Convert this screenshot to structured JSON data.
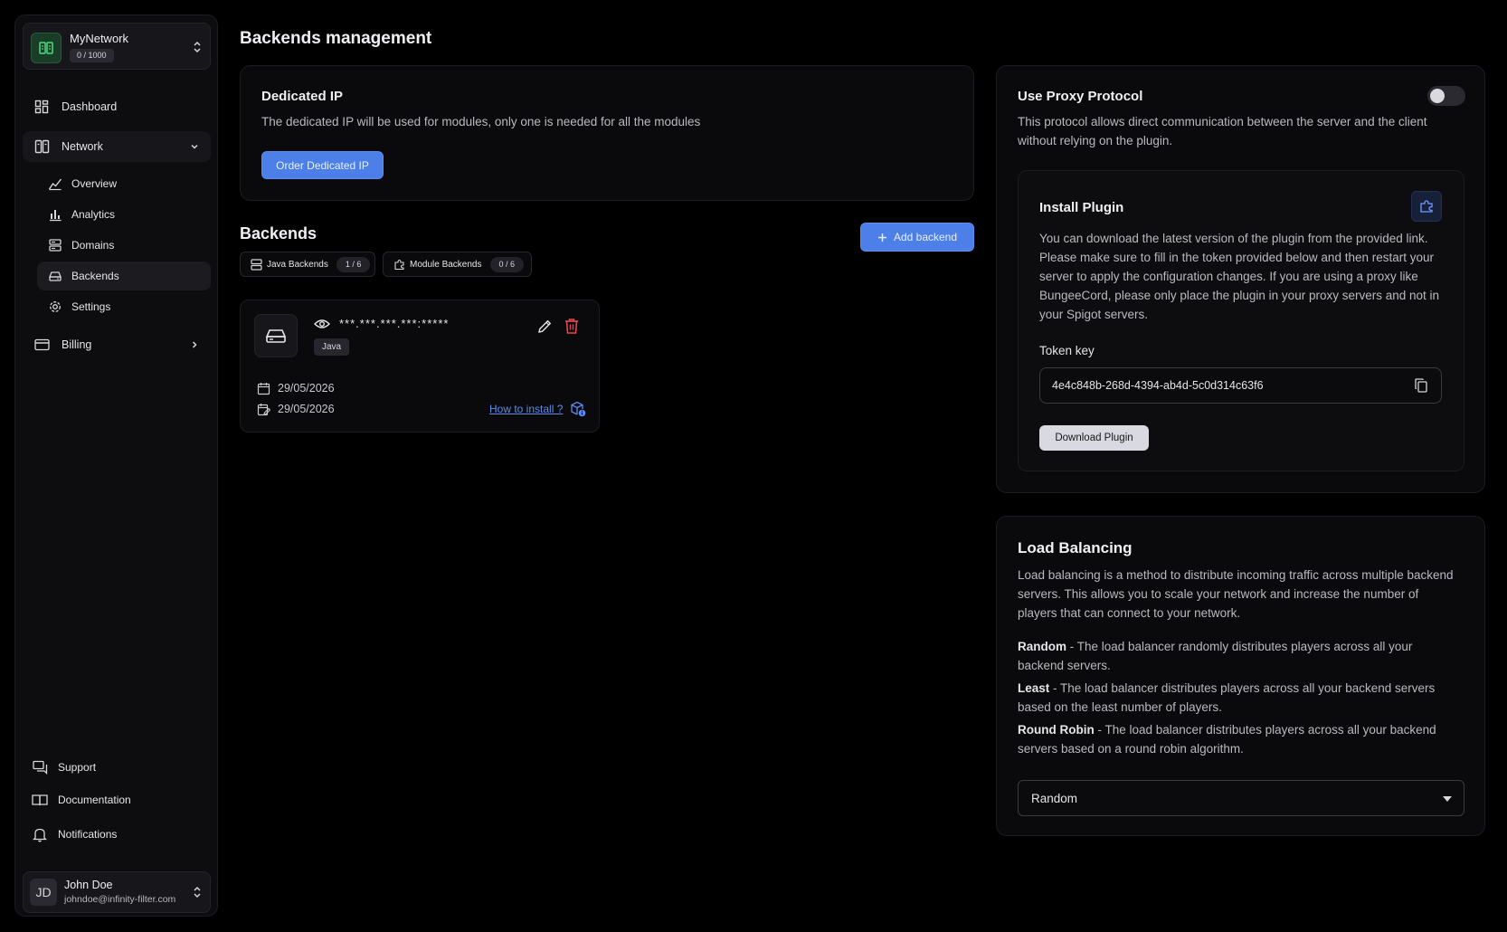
{
  "network": {
    "name": "MyNetwork",
    "count": "0 / 1000"
  },
  "nav": {
    "dashboard": "Dashboard",
    "network": "Network",
    "sub": {
      "overview": "Overview",
      "analytics": "Analytics",
      "domains": "Domains",
      "backends": "Backends",
      "settings": "Settings"
    },
    "billing": "Billing",
    "support": "Support",
    "documentation": "Documentation",
    "notifications": "Notifications"
  },
  "user": {
    "initials": "JD",
    "name": "John Doe",
    "email": "johndoe@infinity-filter.com"
  },
  "page": {
    "title": "Backends management"
  },
  "dedicated": {
    "title": "Dedicated IP",
    "text": "The dedicated IP will be used for modules, only one is needed for all the modules",
    "button": "Order Dedicated IP"
  },
  "backends": {
    "title": "Backends",
    "add_button": "Add backend",
    "tabs": [
      {
        "label": "Java Backends",
        "count": "1 / 6"
      },
      {
        "label": "Module Backends",
        "count": "0 / 6"
      }
    ],
    "card": {
      "address": "***.***.***.***:*****",
      "tag": "Java",
      "date1": "29/05/2026",
      "date2": "29/05/2026",
      "link": "How to install ?"
    }
  },
  "proxy": {
    "title": "Use Proxy Protocol",
    "enabled": false,
    "text": "This protocol allows direct communication between the server and the client without relying on the plugin."
  },
  "plugin": {
    "title": "Install Plugin",
    "text": "You can download the latest version of the plugin from the provided link. Please make sure to fill in the token provided below and then restart your server to apply the configuration changes. If you are using a proxy like BungeeCord, please only place the plugin in your proxy servers and not in your Spigot servers.",
    "token_label": "Token key",
    "token_value": "4e4c848b-268d-4394-ab4d-5c0d314c63f6",
    "download": "Download Plugin"
  },
  "load_balancing": {
    "title": "Load Balancing",
    "intro": "Load balancing is a method to distribute incoming traffic across multiple backend servers. This allows you to scale your network and increase the number of players that can connect to your network.",
    "modes": [
      {
        "name": "Random",
        "desc": " - The load balancer randomly distributes players across all your backend servers."
      },
      {
        "name": "Least",
        "desc": " - The load balancer distributes players across all your backend servers based on the least number of players."
      },
      {
        "name": "Round Robin",
        "desc": " - The load balancer distributes players across all your backend servers based on a round robin algorithm."
      }
    ],
    "selected": "Random"
  },
  "colors": {
    "accent": "#4c7fe8",
    "danger": "#e5484d",
    "background": "#000000"
  }
}
